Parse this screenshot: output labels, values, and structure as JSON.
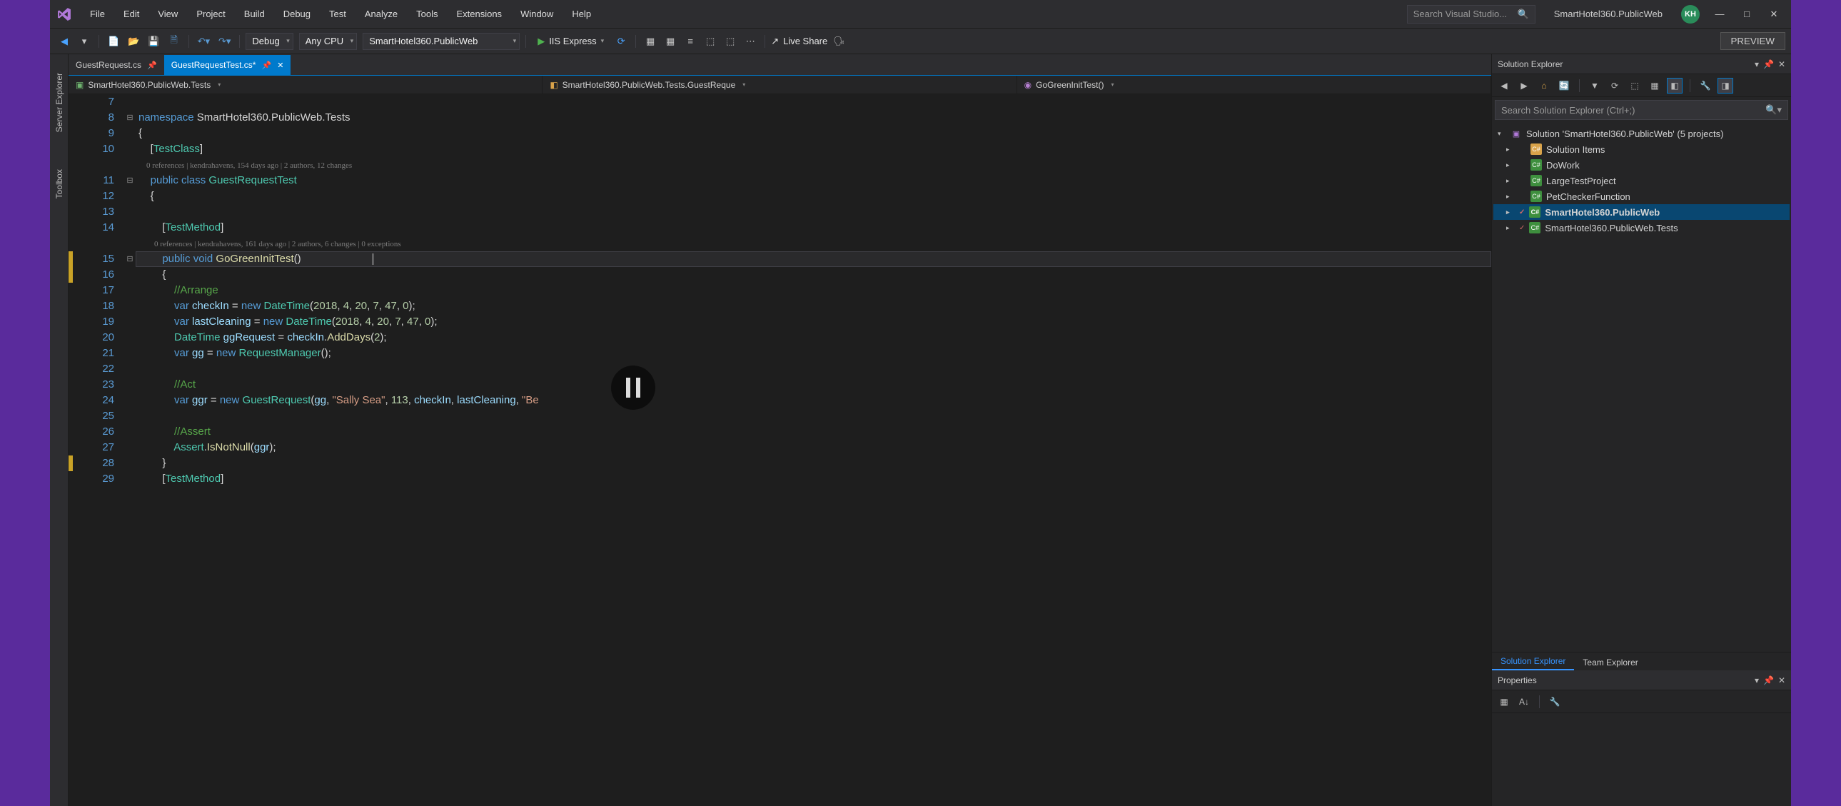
{
  "title": "SmartHotel360.PublicWeb",
  "user_initials": "KH",
  "search_placeholder": "Search Visual Studio...",
  "menu": [
    "File",
    "Edit",
    "View",
    "Project",
    "Build",
    "Debug",
    "Test",
    "Analyze",
    "Tools",
    "Extensions",
    "Window",
    "Help"
  ],
  "toolbar": {
    "config": "Debug",
    "platform": "Any CPU",
    "startup": "SmartHotel360.PublicWeb",
    "run_target": "IIS Express",
    "live_share": "Live Share",
    "preview": "PREVIEW"
  },
  "left_rail": [
    "Server Explorer",
    "Toolbox"
  ],
  "tabs": [
    {
      "name": "GuestRequest.cs",
      "active": false,
      "dirty": false,
      "pinned": true
    },
    {
      "name": "GuestRequestTest.cs",
      "active": true,
      "dirty": true,
      "pinned": true
    }
  ],
  "crumbs": {
    "project": "SmartHotel360.PublicWeb.Tests",
    "class": "SmartHotel360.PublicWeb.Tests.GuestReque",
    "member": "GoGreenInitTest()"
  },
  "code": {
    "first_line": 7,
    "lines": [
      {
        "n": 7,
        "type": "blank"
      },
      {
        "n": 8,
        "fold": "-",
        "tokens": [
          [
            "kw",
            "namespace"
          ],
          [
            "plain",
            " "
          ],
          [
            "plain",
            "SmartHotel360.PublicWeb.Tests"
          ]
        ]
      },
      {
        "n": 9,
        "tokens": [
          [
            "punc",
            "{"
          ]
        ]
      },
      {
        "n": 10,
        "indent": 1,
        "tokens": [
          [
            "punc",
            "["
          ],
          [
            "type",
            "TestClass"
          ],
          [
            "punc",
            "]"
          ]
        ]
      },
      {
        "n": 0,
        "codelens": "0 references | kendrahavens, 154 days ago | 2 authors, 12 changes",
        "indent": 1
      },
      {
        "n": 11,
        "fold": "-",
        "indent": 1,
        "tokens": [
          [
            "kw",
            "public"
          ],
          [
            "plain",
            " "
          ],
          [
            "kw",
            "class"
          ],
          [
            "plain",
            " "
          ],
          [
            "type",
            "GuestRequestTest"
          ]
        ]
      },
      {
        "n": 12,
        "indent": 1,
        "tokens": [
          [
            "punc",
            "{"
          ]
        ]
      },
      {
        "n": 13,
        "type": "blank"
      },
      {
        "n": 14,
        "indent": 2,
        "tokens": [
          [
            "punc",
            "["
          ],
          [
            "type",
            "TestMethod"
          ],
          [
            "punc",
            "]"
          ]
        ]
      },
      {
        "n": 0,
        "codelens": "0 references | kendrahavens, 161 days ago | 2 authors, 6 changes | 0 exceptions",
        "indent": 2
      },
      {
        "n": 15,
        "change": "y",
        "fold": "-",
        "indent": 2,
        "current": true,
        "tokens": [
          [
            "kw",
            "public"
          ],
          [
            "plain",
            " "
          ],
          [
            "kw",
            "void"
          ],
          [
            "plain",
            " "
          ],
          [
            "method",
            "GoGreenInitTest"
          ],
          [
            "punc",
            "()"
          ]
        ]
      },
      {
        "n": 16,
        "change": "y",
        "indent": 2,
        "tokens": [
          [
            "punc",
            "{"
          ]
        ]
      },
      {
        "n": 17,
        "indent": 3,
        "tokens": [
          [
            "comment",
            "//Arrange"
          ]
        ]
      },
      {
        "n": 18,
        "indent": 3,
        "tokens": [
          [
            "kw",
            "var"
          ],
          [
            "plain",
            " "
          ],
          [
            "ident",
            "checkIn"
          ],
          [
            "plain",
            " = "
          ],
          [
            "kw",
            "new"
          ],
          [
            "plain",
            " "
          ],
          [
            "type",
            "DateTime"
          ],
          [
            "punc",
            "("
          ],
          [
            "num",
            "2018"
          ],
          [
            "punc",
            ", "
          ],
          [
            "num",
            "4"
          ],
          [
            "punc",
            ", "
          ],
          [
            "num",
            "20"
          ],
          [
            "punc",
            ", "
          ],
          [
            "num",
            "7"
          ],
          [
            "punc",
            ", "
          ],
          [
            "num",
            "47"
          ],
          [
            "punc",
            ", "
          ],
          [
            "num",
            "0"
          ],
          [
            "punc",
            ");"
          ]
        ]
      },
      {
        "n": 19,
        "indent": 3,
        "tokens": [
          [
            "kw",
            "var"
          ],
          [
            "plain",
            " "
          ],
          [
            "ident",
            "lastCleaning"
          ],
          [
            "plain",
            " = "
          ],
          [
            "kw",
            "new"
          ],
          [
            "plain",
            " "
          ],
          [
            "type",
            "DateTime"
          ],
          [
            "punc",
            "("
          ],
          [
            "num",
            "2018"
          ],
          [
            "punc",
            ", "
          ],
          [
            "num",
            "4"
          ],
          [
            "punc",
            ", "
          ],
          [
            "num",
            "20"
          ],
          [
            "punc",
            ", "
          ],
          [
            "num",
            "7"
          ],
          [
            "punc",
            ", "
          ],
          [
            "num",
            "47"
          ],
          [
            "punc",
            ", "
          ],
          [
            "num",
            "0"
          ],
          [
            "punc",
            ");"
          ]
        ]
      },
      {
        "n": 20,
        "indent": 3,
        "tokens": [
          [
            "type",
            "DateTime"
          ],
          [
            "plain",
            " "
          ],
          [
            "ident",
            "ggRequest"
          ],
          [
            "plain",
            " = "
          ],
          [
            "ident",
            "checkIn"
          ],
          [
            "punc",
            "."
          ],
          [
            "method",
            "AddDays"
          ],
          [
            "punc",
            "("
          ],
          [
            "num",
            "2"
          ],
          [
            "punc",
            ");"
          ]
        ]
      },
      {
        "n": 21,
        "indent": 3,
        "tokens": [
          [
            "kw",
            "var"
          ],
          [
            "plain",
            " "
          ],
          [
            "ident",
            "gg"
          ],
          [
            "plain",
            " = "
          ],
          [
            "kw",
            "new"
          ],
          [
            "plain",
            " "
          ],
          [
            "type",
            "RequestManager"
          ],
          [
            "punc",
            "();"
          ]
        ]
      },
      {
        "n": 22,
        "type": "blank"
      },
      {
        "n": 23,
        "indent": 3,
        "tokens": [
          [
            "comment",
            "//Act"
          ]
        ]
      },
      {
        "n": 24,
        "indent": 3,
        "tokens": [
          [
            "kw",
            "var"
          ],
          [
            "plain",
            " "
          ],
          [
            "ident",
            "ggr"
          ],
          [
            "plain",
            " = "
          ],
          [
            "kw",
            "new"
          ],
          [
            "plain",
            " "
          ],
          [
            "type",
            "GuestRequest"
          ],
          [
            "punc",
            "("
          ],
          [
            "ident",
            "gg"
          ],
          [
            "punc",
            ", "
          ],
          [
            "str",
            "\"Sally Sea\""
          ],
          [
            "punc",
            ", "
          ],
          [
            "num",
            "113"
          ],
          [
            "punc",
            ", "
          ],
          [
            "ident",
            "checkIn"
          ],
          [
            "punc",
            ", "
          ],
          [
            "ident",
            "lastCleaning"
          ],
          [
            "punc",
            ", "
          ],
          [
            "str",
            "\"Be"
          ]
        ]
      },
      {
        "n": 25,
        "type": "blank"
      },
      {
        "n": 26,
        "indent": 3,
        "tokens": [
          [
            "comment",
            "//Assert"
          ]
        ]
      },
      {
        "n": 27,
        "indent": 3,
        "tokens": [
          [
            "type",
            "Assert"
          ],
          [
            "punc",
            "."
          ],
          [
            "method",
            "IsNotNull"
          ],
          [
            "punc",
            "("
          ],
          [
            "ident",
            "ggr"
          ],
          [
            "punc",
            ");"
          ]
        ]
      },
      {
        "n": 28,
        "change": "y",
        "indent": 2,
        "tokens": [
          [
            "punc",
            "}"
          ]
        ]
      },
      {
        "n": 29,
        "indent": 2,
        "tokens": [
          [
            "punc",
            "["
          ],
          [
            "type",
            "TestMethod"
          ],
          [
            "punc",
            "]"
          ]
        ]
      }
    ]
  },
  "solution_explorer": {
    "title": "Solution Explorer",
    "search_placeholder": "Search Solution Explorer (Ctrl+;)",
    "root": "Solution 'SmartHotel360.PublicWeb' (5 projects)",
    "items": [
      {
        "name": "Solution Items",
        "icon": "folder",
        "color": "#d9a34a"
      },
      {
        "name": "DoWork",
        "icon": "csproj",
        "color": "#3e8f3e"
      },
      {
        "name": "LargeTestProject",
        "icon": "csproj",
        "color": "#3e8f3e"
      },
      {
        "name": "PetCheckerFunction",
        "icon": "csproj",
        "color": "#3e8f3e"
      },
      {
        "name": "SmartHotel360.PublicWeb",
        "icon": "csproj",
        "color": "#3e8f3e",
        "bold": true,
        "selected": true,
        "changed": true
      },
      {
        "name": "SmartHotel360.PublicWeb.Tests",
        "icon": "csproj",
        "color": "#3e8f3e",
        "changed": true
      }
    ],
    "bottom_tabs": {
      "active": "Solution Explorer",
      "other": "Team Explorer"
    }
  },
  "properties": {
    "title": "Properties"
  }
}
